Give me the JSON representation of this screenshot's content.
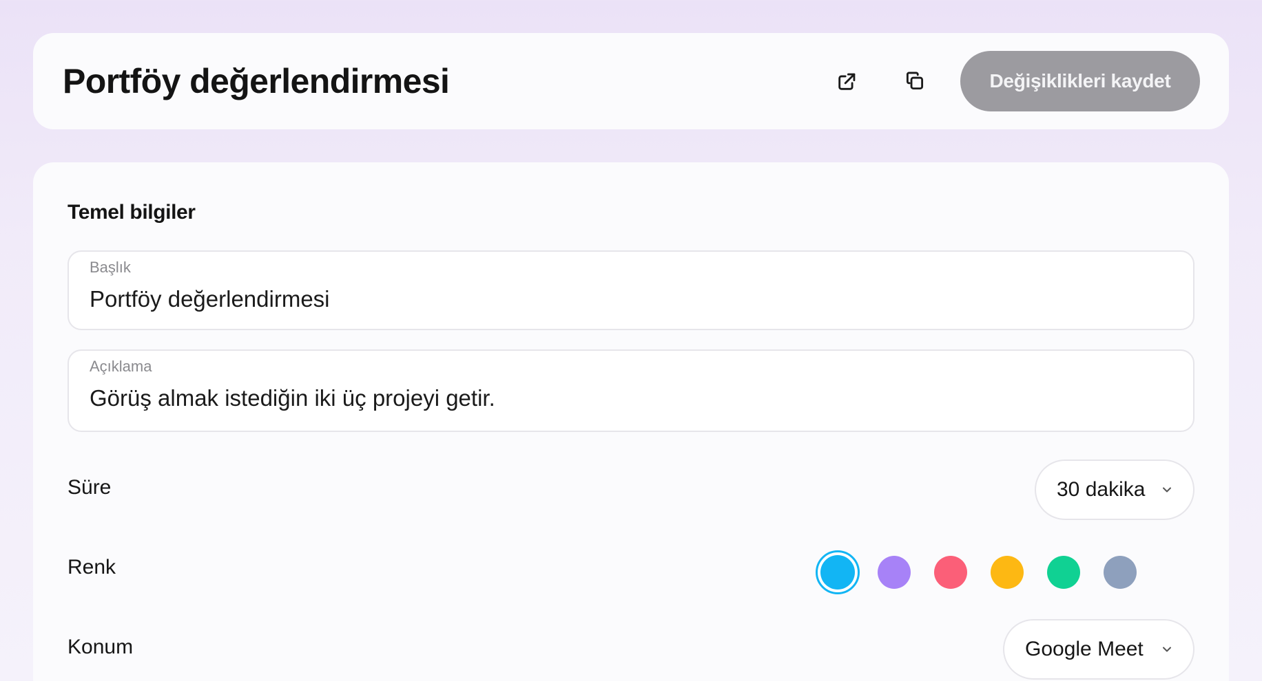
{
  "header": {
    "title": "Portföy değerlendirmesi",
    "open_icon": "external-link-icon",
    "copy_icon": "copy-icon",
    "save_label": "Değişiklikleri kaydet"
  },
  "basics": {
    "section_title": "Temel bilgiler",
    "title_field": {
      "label": "Başlık",
      "value": "Portföy değerlendirmesi"
    },
    "description_field": {
      "label": "Açıklama",
      "value": "Görüş almak istediğin iki üç projeyi getir."
    },
    "duration": {
      "label": "Süre",
      "value": "30 dakika"
    },
    "color": {
      "label": "Renk",
      "options": [
        "#12b5f4",
        "#a782f7",
        "#fb5f78",
        "#fdb813",
        "#10d193",
        "#8ea0bd"
      ],
      "selected_index": 0
    },
    "location": {
      "label": "Konum",
      "value": "Google Meet"
    }
  },
  "colors": {
    "save_button_bg": "#9c9ba0",
    "card_bg": "#fbfbfd",
    "selected_ring": "#12b5f4"
  }
}
